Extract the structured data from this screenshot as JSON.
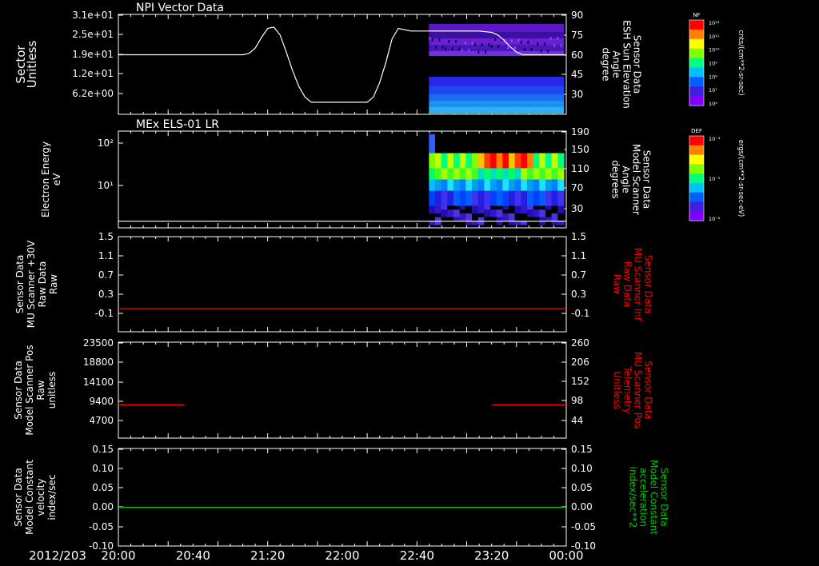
{
  "date_label": "2012/203",
  "time_ticks": [
    "20:00",
    "20:40",
    "21:20",
    "22:00",
    "22:40",
    "23:20",
    "00:00"
  ],
  "colors": {
    "background": "#000000",
    "axis": "#ffffff",
    "red_series": "#ff0000",
    "green_series": "#00cc00"
  },
  "colorbars": [
    {
      "title": "NF",
      "unit": "cnts/(cm**2-sr-sec)",
      "ticks": [
        "10¹²",
        "10¹¹",
        "10¹⁰",
        "10⁹",
        "10⁸",
        "10⁷",
        "10⁶"
      ]
    },
    {
      "title": "DEF",
      "unit": "ergs/(cm**2-sr-sec-eV)",
      "ticks": [
        "10⁻⁴",
        "10⁻⁵",
        "10⁻⁶"
      ]
    }
  ],
  "chart_data": [
    {
      "type": "line",
      "panel_title": "NPI Vector Data",
      "left_axis_label": [
        "Sector",
        "Unitless"
      ],
      "right_axis_label": [
        "Sensor Data",
        "ESH Sun Elevation",
        "Angle",
        "degree"
      ],
      "left_ticks": [
        "3.1e+01",
        "2.5e+01",
        "1.9e+01",
        "1.2e+01",
        "6.2e+00"
      ],
      "right_ticks": [
        "90",
        "75",
        "60",
        "45",
        "30"
      ],
      "right_ylim": [
        15,
        90
      ],
      "series": [
        {
          "x_minutes": [
            0,
            95,
            100,
            105,
            110,
            115,
            120,
            125,
            130,
            135,
            140,
            145,
            150,
            155,
            160,
            170,
            180,
            190,
            200,
            205,
            210,
            215,
            220,
            225,
            230,
            235,
            240,
            250,
            270,
            290,
            300,
            305,
            310,
            315,
            320,
            325,
            330,
            340,
            360
          ],
          "values": [
            60,
            60,
            60,
            61,
            65,
            73,
            80,
            81,
            75,
            62,
            48,
            36,
            28,
            24,
            24,
            24,
            24,
            24,
            24,
            28,
            39,
            54,
            72,
            80,
            79,
            78,
            78,
            78,
            78,
            78,
            77,
            75,
            71,
            66,
            62,
            60,
            60,
            60,
            60
          ]
        }
      ],
      "spectrogram_x_range_minutes": [
        249,
        360
      ]
    },
    {
      "type": "heatmap",
      "panel_title": "MEx ELS-01 LR",
      "left_axis_label": [
        "Electron Energy",
        "eV"
      ],
      "right_axis_label": [
        "Sensor Data",
        "Model Scanner",
        "Angle",
        "degrees"
      ],
      "left_ticks": [
        "10²",
        "10¹"
      ],
      "right_ticks": [
        "190",
        "150",
        "110",
        "70",
        "30"
      ],
      "right_ylim": [
        0,
        190
      ],
      "spectrogram_x_range_minutes": [
        249,
        360
      ],
      "line_series": {
        "x_minutes": [
          0,
          360
        ],
        "values": [
          10,
          10
        ]
      }
    },
    {
      "type": "line",
      "left_axis_label": [
        "Sensor Data",
        "MU Scanner +30V",
        "Raw Data",
        "Raw"
      ],
      "right_axis_label": [
        "Sensor Data",
        "MU Scanner Inf",
        "Raw Data",
        "Raw"
      ],
      "left_ticks": [
        "1.5",
        "1.1",
        "0.7",
        "0.3",
        "-0.1"
      ],
      "right_ticks": [
        "1.5",
        "1.1",
        "0.7",
        "0.3",
        "-0.1"
      ],
      "ylim": [
        -0.5,
        1.5
      ],
      "series": [
        {
          "x_minutes": [
            0,
            360
          ],
          "values": [
            0,
            0
          ]
        }
      ]
    },
    {
      "type": "line",
      "left_axis_label": [
        "Sensor Data",
        "Model Scanner Pos",
        "Raw",
        "unitless"
      ],
      "right_axis_label": [
        "Sensor Data",
        "MU Scanner Pos",
        "Telemetry",
        "Unitless"
      ],
      "left_ticks": [
        "23500",
        "18800",
        "14100",
        "9400",
        "4700"
      ],
      "right_ticks": [
        "260",
        "206",
        "152",
        "98",
        "44"
      ],
      "ylim": [
        0,
        23500
      ],
      "series": [
        {
          "x_minutes": [
            0,
            53
          ],
          "values": [
            8500,
            8500
          ]
        },
        {
          "x_minutes": [
            300,
            360
          ],
          "values": [
            8500,
            8500
          ]
        }
      ]
    },
    {
      "type": "line",
      "left_axis_label": [
        "Sensor Data",
        "Model Constant",
        "velocity",
        "index/sec"
      ],
      "right_axis_label": [
        "Sensor Data",
        "Model Constant",
        "acceleration",
        "index/sec**2"
      ],
      "left_ticks": [
        "0.15",
        "0.10",
        "0.05",
        "0.00",
        "-0.05",
        "-0.10"
      ],
      "right_ticks": [
        "0.15",
        "0.10",
        "0.05",
        "0.00",
        "-0.05",
        "-0.10"
      ],
      "ylim": [
        -0.1,
        0.15
      ],
      "series": [
        {
          "x_minutes": [
            0,
            360
          ],
          "values": [
            0,
            0
          ]
        }
      ]
    }
  ]
}
